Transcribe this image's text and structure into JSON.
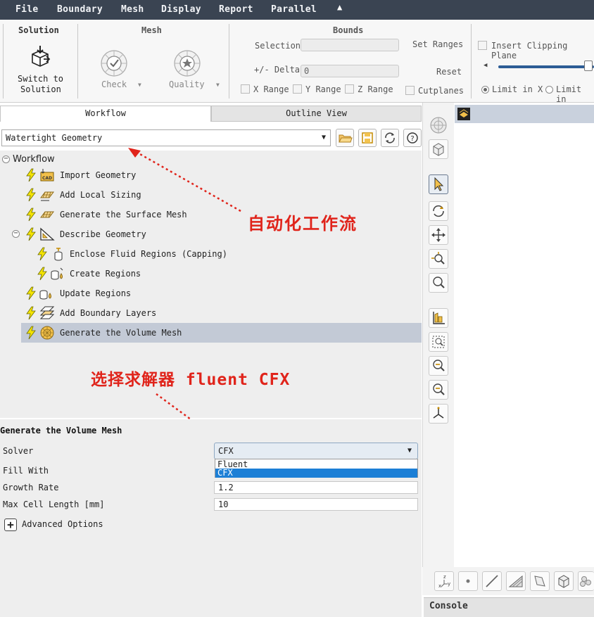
{
  "menu": {
    "items": [
      "File",
      "Boundary",
      "Mesh",
      "Display",
      "Report",
      "Parallel"
    ],
    "collapse_icon": "caret-up-icon"
  },
  "ribbon": {
    "solution": {
      "title": "Solution",
      "switch_label_1": "Switch to",
      "switch_label_2": "Solution"
    },
    "mesh": {
      "title": "Mesh",
      "check_label": "Check",
      "quality_label": "Quality"
    },
    "bounds": {
      "title": "Bounds",
      "selection_label": "Selection",
      "selection_value": "",
      "delta_label": "+/- Delta",
      "delta_value": "0",
      "set_ranges": "Set Ranges",
      "reset": "Reset",
      "x_range": "X Range",
      "y_range": "Y Range",
      "z_range": "Z Range",
      "cutplanes": "Cutplanes"
    },
    "clipping": {
      "insert_label": "Insert Clipping Plane",
      "limit_x": "Limit in X",
      "limit_other": "Limit in",
      "slider_value": 0.97
    }
  },
  "tabs": {
    "workflow": "Workflow",
    "outline": "Outline View"
  },
  "workflow_select": {
    "value": "Watertight Geometry"
  },
  "tree": {
    "root": "Workflow",
    "items": [
      {
        "label": "Import Geometry",
        "icon": "cad-import-icon"
      },
      {
        "label": "Add Local Sizing",
        "icon": "local-sizing-icon"
      },
      {
        "label": "Generate the Surface Mesh",
        "icon": "surface-mesh-icon"
      },
      {
        "label": "Describe Geometry",
        "icon": "describe-geometry-icon"
      },
      {
        "label": "Enclose Fluid Regions (Capping)",
        "icon": "capping-icon"
      },
      {
        "label": "Create Regions",
        "icon": "create-regions-icon"
      },
      {
        "label": "Update Regions",
        "icon": "update-regions-icon"
      },
      {
        "label": "Add Boundary Layers",
        "icon": "boundary-layers-icon"
      },
      {
        "label": "Generate the Volume Mesh",
        "icon": "volume-mesh-icon"
      }
    ]
  },
  "annotations": {
    "workflow_note": "自动化工作流",
    "solver_note": "选择求解器 fluent CFX"
  },
  "props": {
    "title": "Generate the Volume Mesh",
    "solver_label": "Solver",
    "solver_value": "CFX",
    "solver_options": [
      "Fluent",
      "CFX"
    ],
    "fill_label": "Fill With",
    "growth_label": "Growth Rate",
    "growth_value": "1.2",
    "max_cell_label": "Max Cell Length [mm]",
    "max_cell_value": "10",
    "advanced_label": "Advanced Options"
  },
  "console": {
    "label": "Console"
  },
  "colors": {
    "menubar": "#3a4452",
    "annotation": "#e0241b",
    "selected_row": "#c3cad6",
    "selected_option": "#1c7fd6",
    "bolt": "#f5e400"
  }
}
